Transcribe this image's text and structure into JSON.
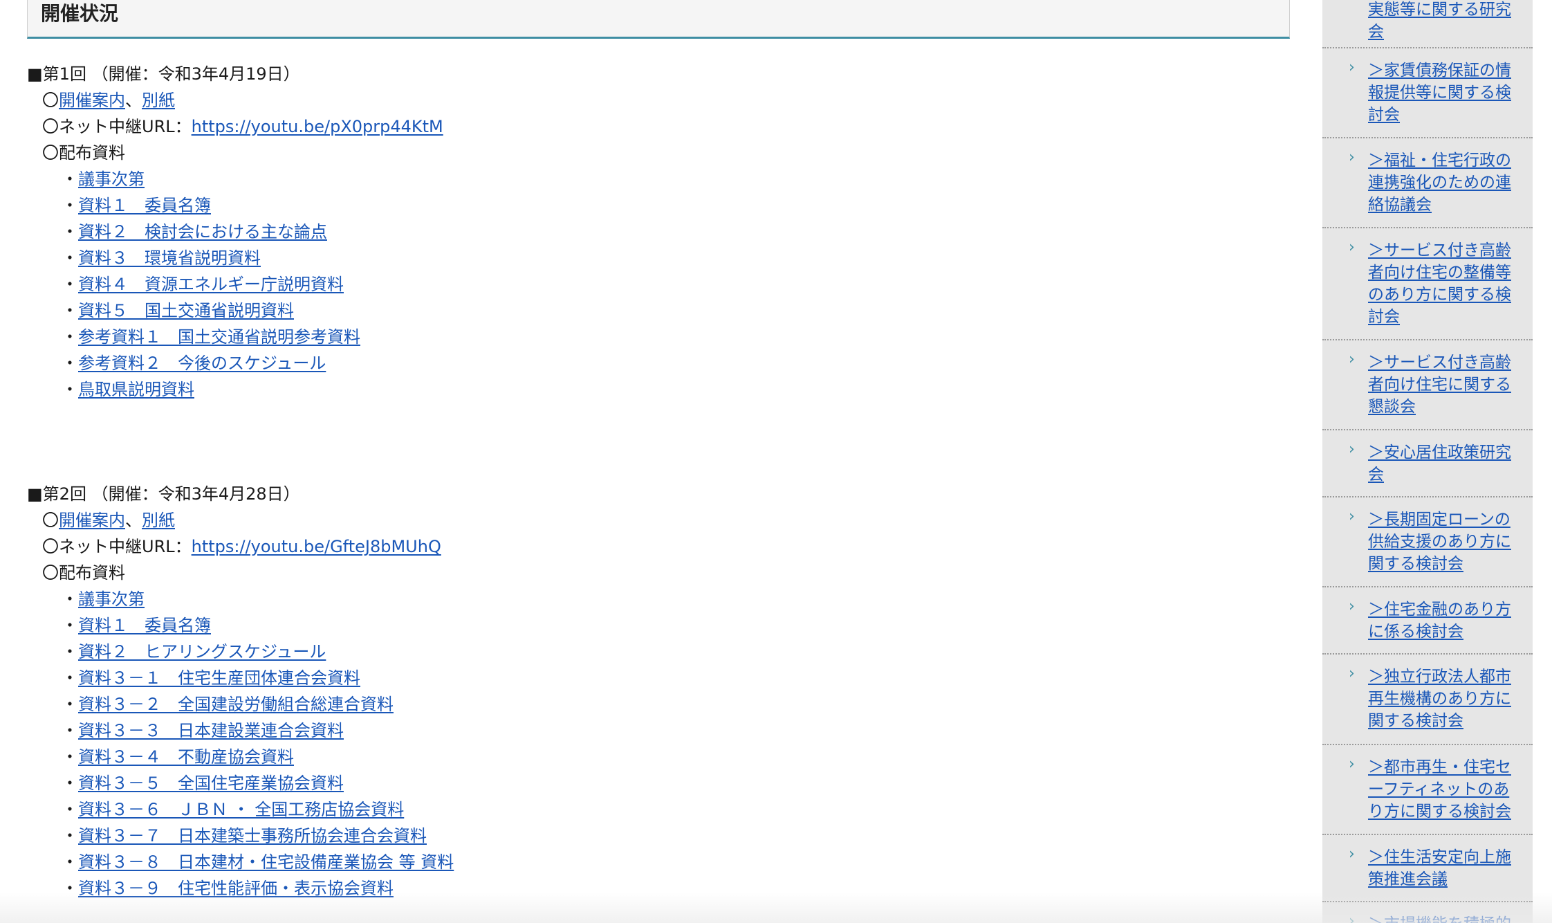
{
  "section_title": "開催状況",
  "meetings": [
    {
      "heading": "■第1回 （開催：令和3年4月19日）",
      "circle": "〇",
      "links_line": {
        "a": "開催案内",
        "sep": "、",
        "b": "別紙"
      },
      "net_label": "〇ネット中継URL：",
      "net_url": "https://youtu.be/pX0prp44KtM",
      "materials_label": "〇配布資料",
      "bullet": "・",
      "materials": [
        "議事次第",
        "資料１　委員名簿",
        "資料２　検討会における主な論点",
        "資料３　環境省説明資料",
        "資料４　資源エネルギー庁説明資料",
        "資料５　国土交通省説明資料",
        "参考資料１　国土交通省説明参考資料",
        "参考資料２　今後のスケジュール",
        "鳥取県説明資料"
      ]
    },
    {
      "heading": "■第2回 （開催：令和3年4月28日）",
      "circle": "〇",
      "links_line": {
        "a": "開催案内",
        "sep": "、",
        "b": "別紙"
      },
      "net_label": "〇ネット中継URL：",
      "net_url": "https://youtu.be/GfteJ8bMUhQ",
      "materials_label": "〇配布資料",
      "bullet": "・",
      "materials": [
        "議事次第",
        "資料１　委員名簿",
        "資料２　ヒアリングスケジュール",
        "資料３－１　住宅生産団体連合会資料",
        "資料３－２　全国建設労働組合総連合資料",
        "資料３－３　日本建設業連合会資料",
        "資料３－４　不動産協会資料",
        "資料３－５　全国住宅産業協会資料",
        "資料３－６　ＪＢＮ ・ 全国工務店協会資料",
        "資料３－７　日本建築士事務所協会連合会資料",
        "資料３－８　日本建材・住宅設備産業協会 等 資料",
        "資料３－９　住宅性能評価・表示協会資料"
      ]
    }
  ],
  "sidebar": {
    "chevron": "›",
    "items": [
      "実態等に関する研究会",
      "＞家賃債務保証の情報提供等に関する検討会",
      "＞福祉・住宅行政の連携強化のための連絡協議会",
      "＞サービス付き高齢者向け住宅の整備等のあり方に関する検討会",
      "＞サービス付き高齢者向け住宅に関する懇談会",
      "＞安心居住政策研究会",
      "＞長期固定ローンの供給支援のあり方に関する検討会",
      "＞住宅金融のあり方に係る検討会",
      "＞独立行政法人都市再生機構のあり方に関する検討会",
      "＞都市再生・住宅セーフティネットのあり方に関する検討会",
      "＞住生活安定向上施策推進会議",
      "＞市場機能を積極的"
    ]
  },
  "colors": {
    "link": "#1a57b8",
    "accent": "#3e8ea3",
    "sidebar_bg": "#e6e6e6"
  }
}
